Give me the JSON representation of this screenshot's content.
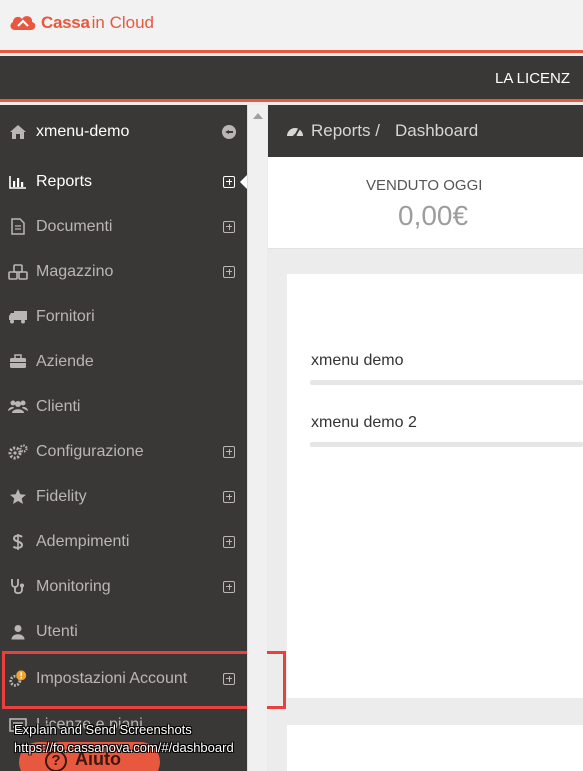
{
  "brand": {
    "name_bold": "Cassa",
    "name_light": "in Cloud",
    "color": "#e8583e"
  },
  "license_bar": {
    "text": "LA LICENZ"
  },
  "sidebar": {
    "header": {
      "label": "xmenu-demo",
      "icon": "home-icon",
      "action_icon": "back-circle-icon"
    },
    "items": [
      {
        "label": "Reports",
        "icon": "bar-chart-icon",
        "expandable": true,
        "active": true
      },
      {
        "label": "Documenti",
        "icon": "document-icon",
        "expandable": true
      },
      {
        "label": "Magazzino",
        "icon": "cubes-icon",
        "expandable": true
      },
      {
        "label": "Fornitori",
        "icon": "truck-icon",
        "expandable": false
      },
      {
        "label": "Aziende",
        "icon": "briefcase-icon",
        "expandable": false
      },
      {
        "label": "Clienti",
        "icon": "users-icon",
        "expandable": false
      },
      {
        "label": "Configurazione",
        "icon": "gears-icon",
        "expandable": true
      },
      {
        "label": "Fidelity",
        "icon": "star-icon",
        "expandable": true
      },
      {
        "label": "Adempimenti",
        "icon": "dollar-icon",
        "expandable": true
      },
      {
        "label": "Monitoring",
        "icon": "stethoscope-icon",
        "expandable": true
      },
      {
        "label": "Utenti",
        "icon": "user-icon",
        "expandable": false
      },
      {
        "label": "Impostazioni Account",
        "icon": "gear-warning-icon",
        "expandable": true
      },
      {
        "label": "Licenze e piani",
        "icon": "license-icon",
        "expandable": false
      }
    ]
  },
  "breadcrumb": {
    "icon": "dashboard-icon",
    "section": "Reports /",
    "page": "Dashboard"
  },
  "sales_today": {
    "label": "VENDUTO OGGI",
    "value": "0,00€"
  },
  "shops": [
    {
      "name": "xmenu demo"
    },
    {
      "name": "xmenu demo 2"
    }
  ],
  "overlay": {
    "line1": "Explain and Send Screenshots",
    "line2": "https://fo.cassanova.com/#/dashboard"
  },
  "help_button": {
    "label": "Aiuto",
    "icon": "question-circle-icon"
  }
}
